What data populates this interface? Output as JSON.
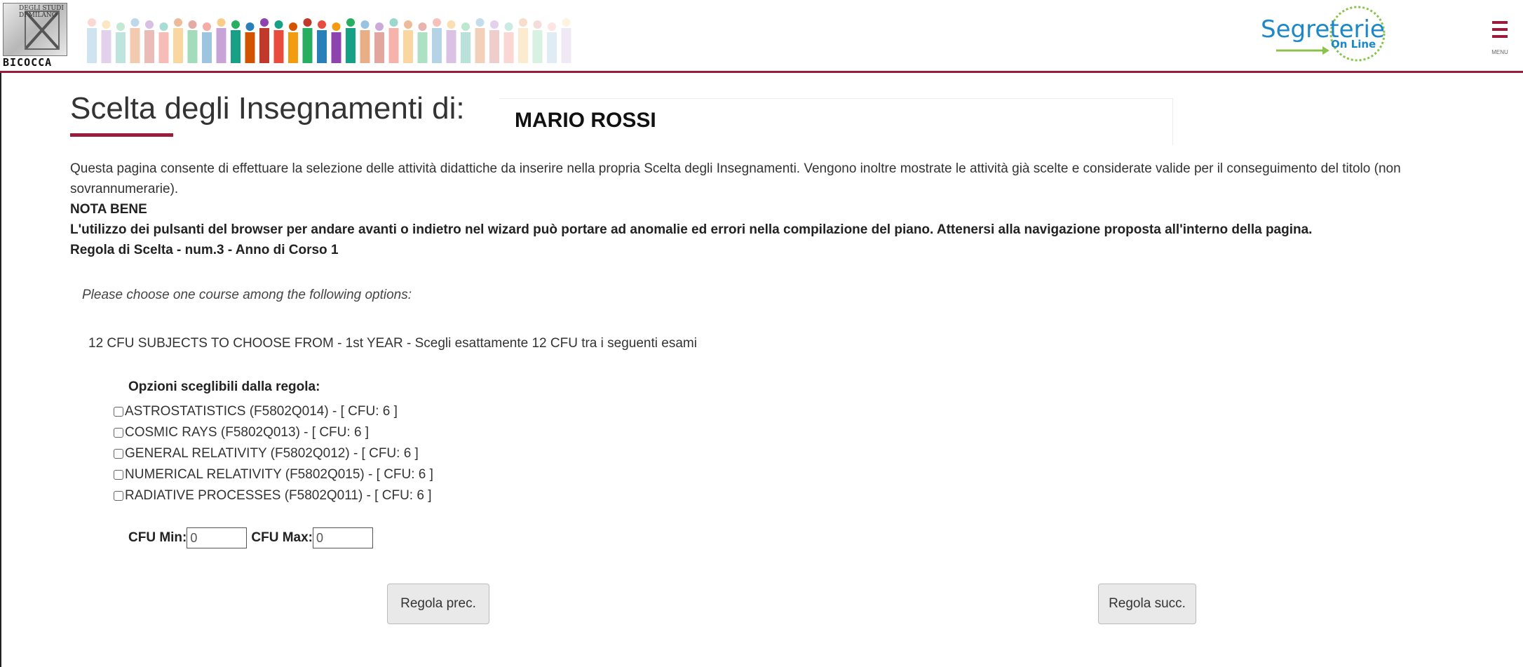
{
  "header": {
    "logo_university_text": "DEGLI STUDI DI MILANO",
    "logo_name": "BICOCCA",
    "segreterie_logo_word": "Segreterie",
    "segreterie_logo_sub": "On Line",
    "menu_label": "MENU",
    "accent_color": "#9b1c3a",
    "segreterie_color": "#1c88c9"
  },
  "page": {
    "title": "Scelta degli Insegnamenti di:",
    "student_name": "MARIO ROSSI",
    "intro": "Questa pagina consente di effettuare la selezione delle attività didattiche da inserire nella propria Scelta degli Insegnamenti. Vengono inoltre mostrate le attività già scelte e considerate valide per il conseguimento del titolo (non sovrannumerarie).",
    "nota_bene_label": "NOTA BENE",
    "warning": "L'utilizzo dei pulsanti del browser per andare avanti o indietro nel wizard può portare ad anomalie ed errori nella compilazione del piano. Attenersi alla navigazione proposta all'interno della pagina.",
    "rule_heading": "Regola di Scelta - num.3 - Anno di Corso 1",
    "rule_note": "Please choose one course among the following options:",
    "rule_description": "12 CFU SUBJECTS TO CHOOSE FROM - 1st YEAR - Scegli esattamente 12 CFU tra i seguenti esami"
  },
  "options": {
    "title": "Opzioni sceglibili dalla regola:",
    "items": [
      {
        "label": "ASTROSTATISTICS (F5802Q014) - [ CFU: 6 ]",
        "checked": false
      },
      {
        "label": "COSMIC RAYS (F5802Q013) - [ CFU: 6 ]",
        "checked": false
      },
      {
        "label": "GENERAL RELATIVITY (F5802Q012) - [ CFU: 6 ]",
        "checked": false
      },
      {
        "label": "NUMERICAL RELATIVITY (F5802Q015) - [ CFU: 6 ]",
        "checked": false
      },
      {
        "label": "RADIATIVE PROCESSES (F5802Q011) - [ CFU: 6 ]",
        "checked": false
      }
    ]
  },
  "cfu": {
    "min_label": "CFU Min:",
    "min_value": "0",
    "max_label": "CFU Max:",
    "max_value": "0"
  },
  "nav": {
    "prev_label": "Regola prec.",
    "next_label": "Regola succ."
  }
}
